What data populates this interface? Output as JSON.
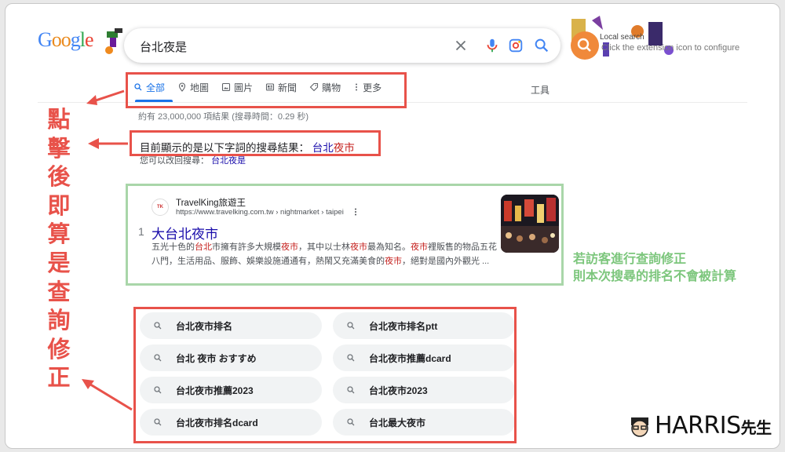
{
  "search": {
    "query": "台北夜是"
  },
  "extension": {
    "title": "Local search",
    "hint": "Click the extension icon to configure"
  },
  "tabs": [
    {
      "label": "全部",
      "icon": "search-icon"
    },
    {
      "label": "地圖",
      "icon": "map-pin-icon"
    },
    {
      "label": "圖片",
      "icon": "image-icon"
    },
    {
      "label": "新聞",
      "icon": "news-icon"
    },
    {
      "label": "購物",
      "icon": "tag-icon"
    },
    {
      "label": "更多",
      "icon": "more-vert-icon"
    }
  ],
  "tools_label": "工具",
  "result_stats": "約有 23,000,000 項結果 (搜尋時間：0.29 秒)",
  "spell": {
    "showing_prefix": "目前顯示的是以下字詞的搜尋結果：",
    "corrected_a": "台北",
    "corrected_b": "夜市",
    "instead_prefix": "您可以改回搜尋：",
    "instead_query": "台北夜是"
  },
  "result": {
    "site_name": "TravelKing旅遊王",
    "url": "https://www.travelking.com.tw › nightmarket › taipei",
    "rank": "1",
    "title": "大台北夜市",
    "snippet": [
      {
        "t": "五光十色的",
        "h": false
      },
      {
        "t": "台北",
        "h": true
      },
      {
        "t": "市擁有許多大規模",
        "h": false
      },
      {
        "t": "夜市",
        "h": true
      },
      {
        "t": "，其中以士林",
        "h": false
      },
      {
        "t": "夜市",
        "h": true
      },
      {
        "t": "最為知名。",
        "h": false
      },
      {
        "t": "夜市",
        "h": true
      },
      {
        "t": "裡販售的物品五花八門，生活用品、服飾、娛樂設施通通有，熱鬧又充滿美食的",
        "h": false
      },
      {
        "t": "夜市",
        "h": true
      },
      {
        "t": "，絕對是國內外觀光 ...",
        "h": false
      }
    ]
  },
  "related": [
    "台北夜市排名",
    "台北夜市排名ptt",
    "台北 夜市 おすすめ",
    "台北夜市推薦dcard",
    "台北夜市推薦2023",
    "台北夜市2023",
    "台北夜市排名dcard",
    "台北最大夜市"
  ],
  "annotations": {
    "left_note": "點擊後即算是查詢修正",
    "right_note_line1": "若訪客進行查詢修正",
    "right_note_line2": "則本次搜尋的排名不會被計算",
    "red_color": "#e8524a",
    "green_color": "#a9d6a9"
  },
  "watermark": {
    "name": "HARRIS",
    "suffix": "先生"
  }
}
